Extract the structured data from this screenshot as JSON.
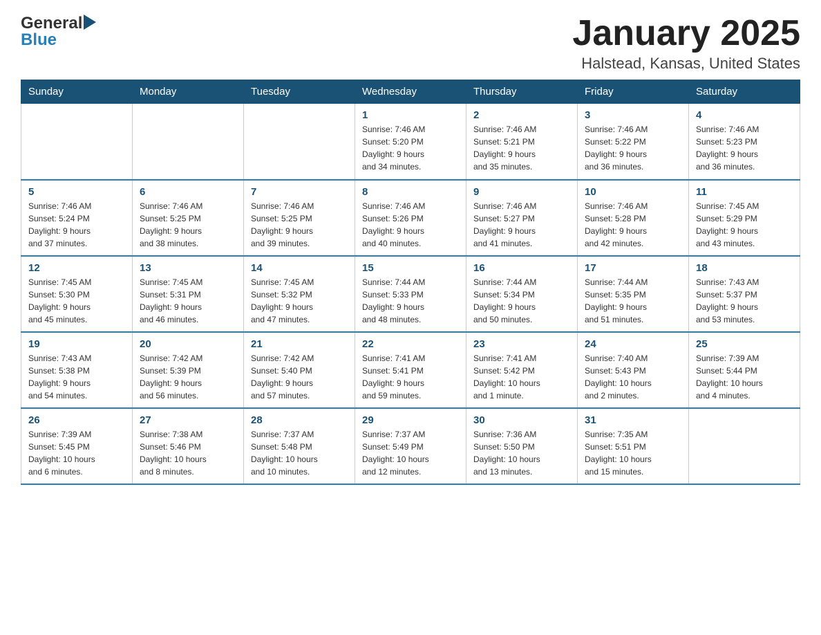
{
  "header": {
    "logo_general": "General",
    "logo_blue": "Blue",
    "month_title": "January 2025",
    "location": "Halstead, Kansas, United States"
  },
  "days_of_week": [
    "Sunday",
    "Monday",
    "Tuesday",
    "Wednesday",
    "Thursday",
    "Friday",
    "Saturday"
  ],
  "weeks": [
    [
      {
        "day": "",
        "info": ""
      },
      {
        "day": "",
        "info": ""
      },
      {
        "day": "",
        "info": ""
      },
      {
        "day": "1",
        "info": "Sunrise: 7:46 AM\nSunset: 5:20 PM\nDaylight: 9 hours\nand 34 minutes."
      },
      {
        "day": "2",
        "info": "Sunrise: 7:46 AM\nSunset: 5:21 PM\nDaylight: 9 hours\nand 35 minutes."
      },
      {
        "day": "3",
        "info": "Sunrise: 7:46 AM\nSunset: 5:22 PM\nDaylight: 9 hours\nand 36 minutes."
      },
      {
        "day": "4",
        "info": "Sunrise: 7:46 AM\nSunset: 5:23 PM\nDaylight: 9 hours\nand 36 minutes."
      }
    ],
    [
      {
        "day": "5",
        "info": "Sunrise: 7:46 AM\nSunset: 5:24 PM\nDaylight: 9 hours\nand 37 minutes."
      },
      {
        "day": "6",
        "info": "Sunrise: 7:46 AM\nSunset: 5:25 PM\nDaylight: 9 hours\nand 38 minutes."
      },
      {
        "day": "7",
        "info": "Sunrise: 7:46 AM\nSunset: 5:25 PM\nDaylight: 9 hours\nand 39 minutes."
      },
      {
        "day": "8",
        "info": "Sunrise: 7:46 AM\nSunset: 5:26 PM\nDaylight: 9 hours\nand 40 minutes."
      },
      {
        "day": "9",
        "info": "Sunrise: 7:46 AM\nSunset: 5:27 PM\nDaylight: 9 hours\nand 41 minutes."
      },
      {
        "day": "10",
        "info": "Sunrise: 7:46 AM\nSunset: 5:28 PM\nDaylight: 9 hours\nand 42 minutes."
      },
      {
        "day": "11",
        "info": "Sunrise: 7:45 AM\nSunset: 5:29 PM\nDaylight: 9 hours\nand 43 minutes."
      }
    ],
    [
      {
        "day": "12",
        "info": "Sunrise: 7:45 AM\nSunset: 5:30 PM\nDaylight: 9 hours\nand 45 minutes."
      },
      {
        "day": "13",
        "info": "Sunrise: 7:45 AM\nSunset: 5:31 PM\nDaylight: 9 hours\nand 46 minutes."
      },
      {
        "day": "14",
        "info": "Sunrise: 7:45 AM\nSunset: 5:32 PM\nDaylight: 9 hours\nand 47 minutes."
      },
      {
        "day": "15",
        "info": "Sunrise: 7:44 AM\nSunset: 5:33 PM\nDaylight: 9 hours\nand 48 minutes."
      },
      {
        "day": "16",
        "info": "Sunrise: 7:44 AM\nSunset: 5:34 PM\nDaylight: 9 hours\nand 50 minutes."
      },
      {
        "day": "17",
        "info": "Sunrise: 7:44 AM\nSunset: 5:35 PM\nDaylight: 9 hours\nand 51 minutes."
      },
      {
        "day": "18",
        "info": "Sunrise: 7:43 AM\nSunset: 5:37 PM\nDaylight: 9 hours\nand 53 minutes."
      }
    ],
    [
      {
        "day": "19",
        "info": "Sunrise: 7:43 AM\nSunset: 5:38 PM\nDaylight: 9 hours\nand 54 minutes."
      },
      {
        "day": "20",
        "info": "Sunrise: 7:42 AM\nSunset: 5:39 PM\nDaylight: 9 hours\nand 56 minutes."
      },
      {
        "day": "21",
        "info": "Sunrise: 7:42 AM\nSunset: 5:40 PM\nDaylight: 9 hours\nand 57 minutes."
      },
      {
        "day": "22",
        "info": "Sunrise: 7:41 AM\nSunset: 5:41 PM\nDaylight: 9 hours\nand 59 minutes."
      },
      {
        "day": "23",
        "info": "Sunrise: 7:41 AM\nSunset: 5:42 PM\nDaylight: 10 hours\nand 1 minute."
      },
      {
        "day": "24",
        "info": "Sunrise: 7:40 AM\nSunset: 5:43 PM\nDaylight: 10 hours\nand 2 minutes."
      },
      {
        "day": "25",
        "info": "Sunrise: 7:39 AM\nSunset: 5:44 PM\nDaylight: 10 hours\nand 4 minutes."
      }
    ],
    [
      {
        "day": "26",
        "info": "Sunrise: 7:39 AM\nSunset: 5:45 PM\nDaylight: 10 hours\nand 6 minutes."
      },
      {
        "day": "27",
        "info": "Sunrise: 7:38 AM\nSunset: 5:46 PM\nDaylight: 10 hours\nand 8 minutes."
      },
      {
        "day": "28",
        "info": "Sunrise: 7:37 AM\nSunset: 5:48 PM\nDaylight: 10 hours\nand 10 minutes."
      },
      {
        "day": "29",
        "info": "Sunrise: 7:37 AM\nSunset: 5:49 PM\nDaylight: 10 hours\nand 12 minutes."
      },
      {
        "day": "30",
        "info": "Sunrise: 7:36 AM\nSunset: 5:50 PM\nDaylight: 10 hours\nand 13 minutes."
      },
      {
        "day": "31",
        "info": "Sunrise: 7:35 AM\nSunset: 5:51 PM\nDaylight: 10 hours\nand 15 minutes."
      },
      {
        "day": "",
        "info": ""
      }
    ]
  ]
}
